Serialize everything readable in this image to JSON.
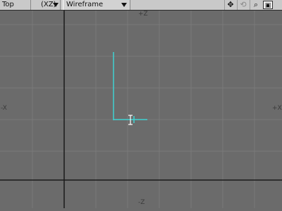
{
  "toolbar": {
    "view_name": "Top",
    "axis": "(XZ)",
    "render_mode": "Wireframe",
    "icons": [
      "move-view-icon",
      "rotate-view-icon",
      "zoom-view-icon",
      "maximize-view-icon"
    ]
  },
  "viewport": {
    "axis_labels": {
      "top": "+Z",
      "bottom": "-Z",
      "left": "-X",
      "right": "+X"
    },
    "colors": {
      "background": "#6b6b6b",
      "grid": "#787878",
      "axis_lines": "#1a1a1a",
      "geometry": "#3fd2d2",
      "cursor": "#ffffff"
    }
  }
}
